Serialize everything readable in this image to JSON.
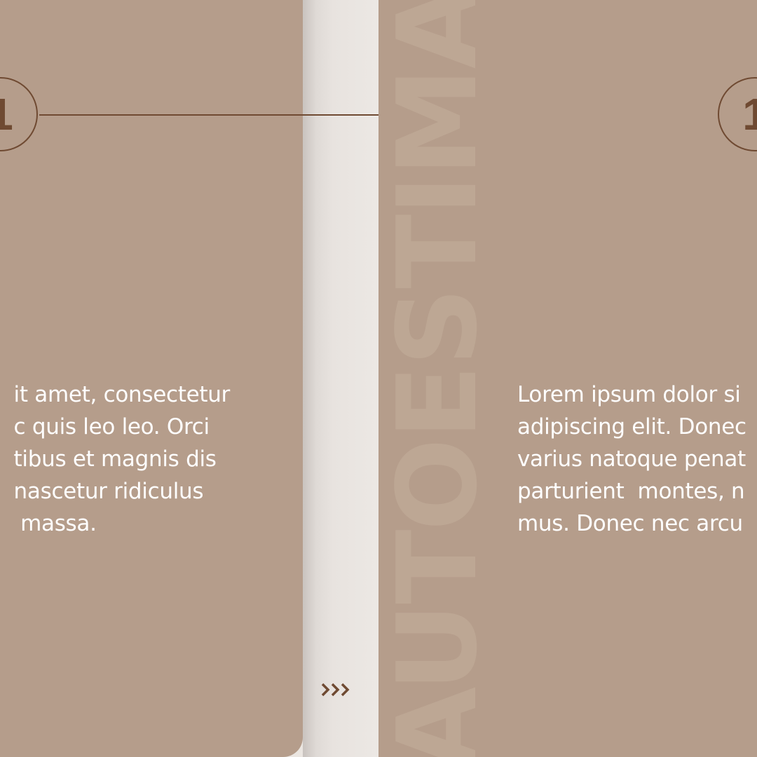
{
  "left_card": {
    "step_number": "1",
    "text": "Lorem ipsum dolor sit amet, consectetur\nadipiscing elit. Donec quis leo leo. Orci\nvarius natoque penatibus et magnis dis\nparturient  montes, nascetur ridiculus\nmus. Donec nec arcu massa.",
    "visible_text": "it amet, consectetur\nc quis leo leo. Orci\ntibus et magnis dis\nnascetur ridiculus\n massa."
  },
  "right_panel": {
    "watermark": "AUTOESTIMA",
    "step_number": "1",
    "text": "Lorem ipsum dolor si\nadipiscing elit. Donec\nvarius natoque penat\nparturient  montes, n\nmus. Donec nec arcu"
  },
  "navigation": {
    "next_icon": "triple-chevron-right-icon"
  },
  "colors": {
    "card": "#b59d8b",
    "accent": "#6f4a32",
    "background": "#ebe6e1",
    "watermark": "#bda794",
    "text": "#ffffff"
  }
}
